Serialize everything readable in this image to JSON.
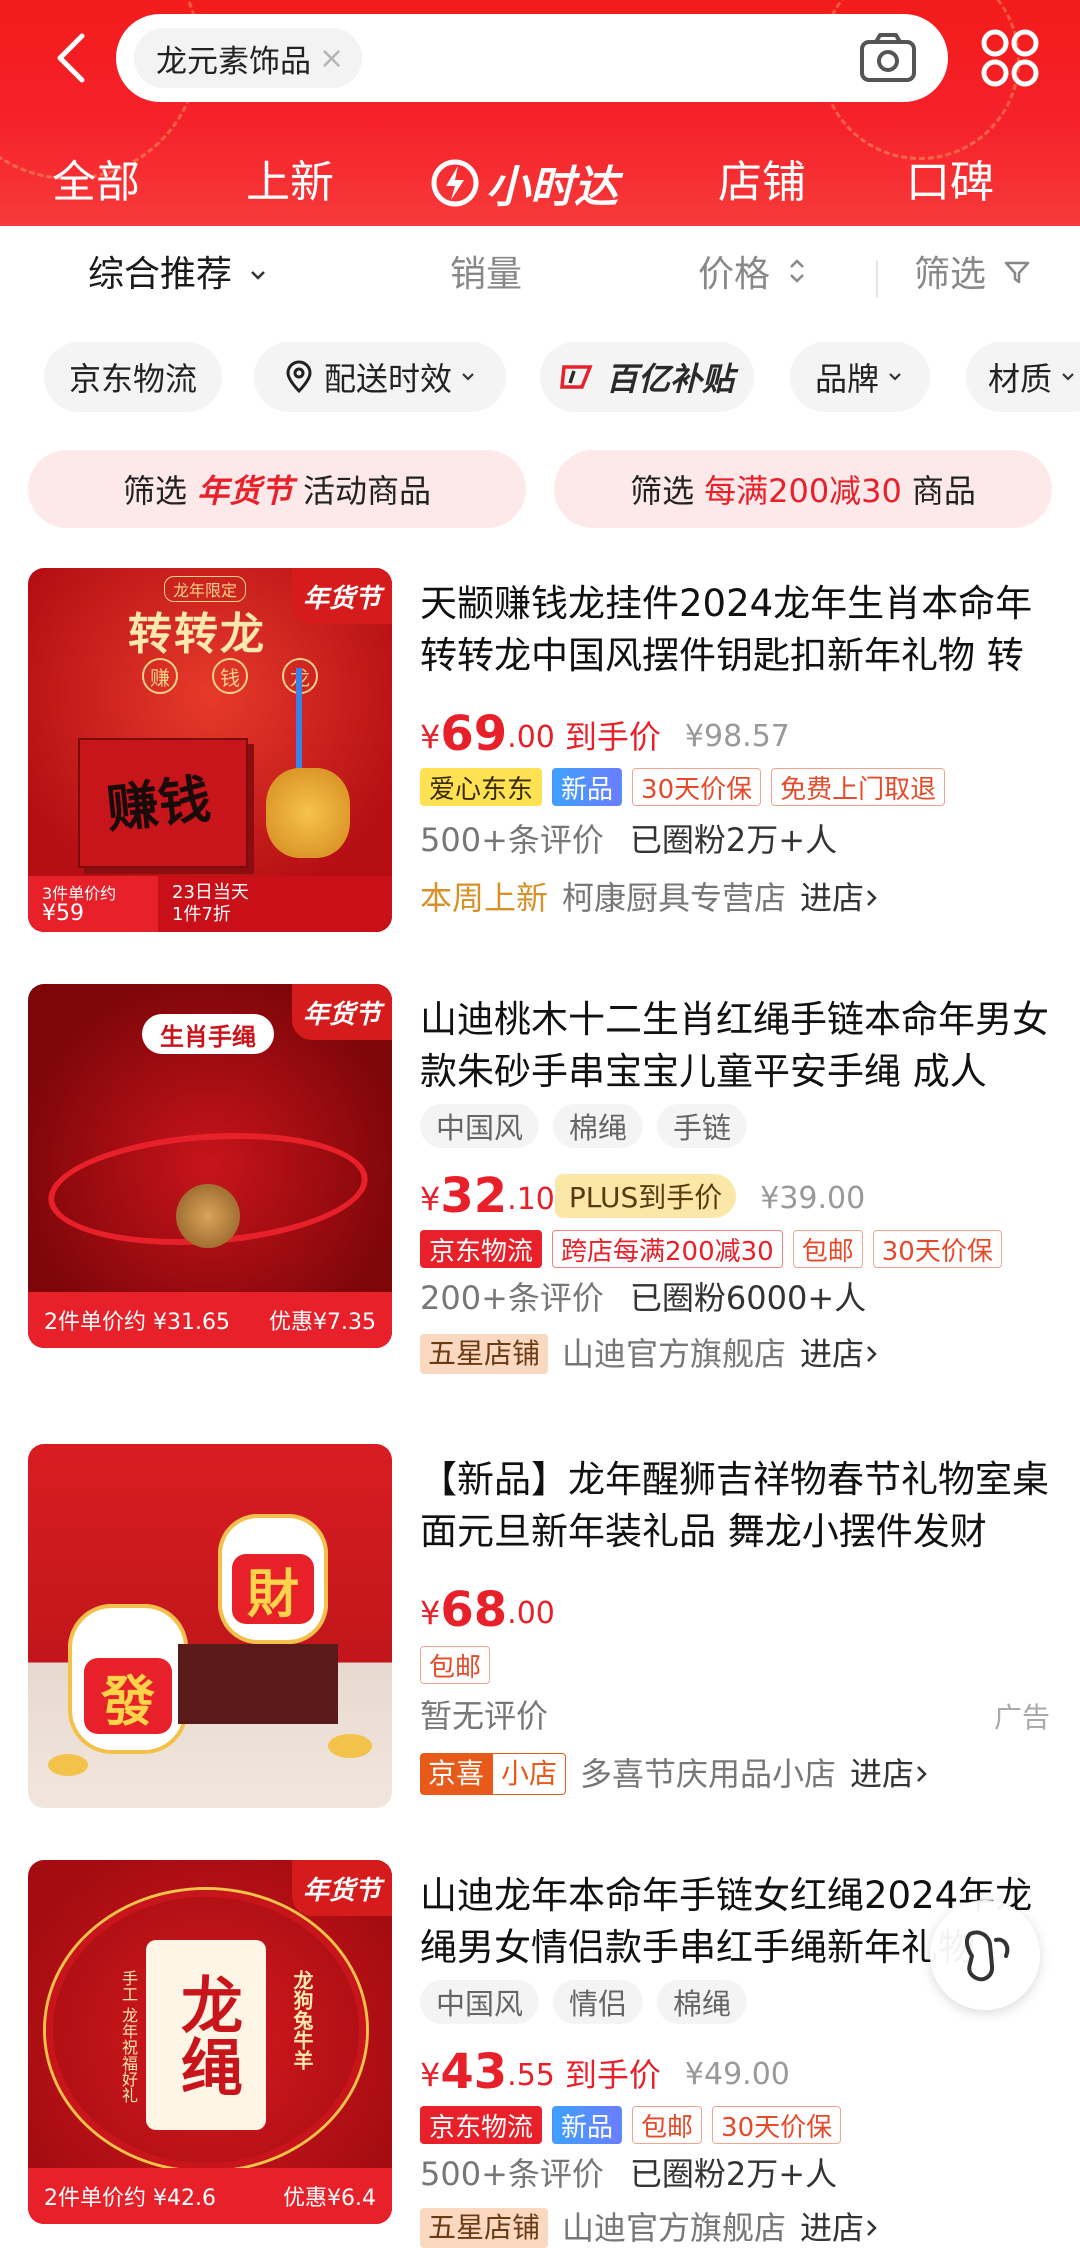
{
  "search": {
    "query": "龙元素饰品",
    "clear": "×"
  },
  "tabs": [
    {
      "label": "全部"
    },
    {
      "label": "上新"
    },
    {
      "label": "小时达"
    },
    {
      "label": "店铺"
    },
    {
      "label": "口碑"
    }
  ],
  "sort": {
    "overall": "综合推荐",
    "sales": "销量",
    "price": "价格",
    "filter": "筛选"
  },
  "filters": [
    "京东物流",
    "配送时效",
    "百亿补贴",
    "品牌",
    "材质"
  ],
  "promos": [
    {
      "prefix": "筛选",
      "highlight": "年货节",
      "suffix": "活动商品"
    },
    {
      "prefix": "筛选",
      "highlight": "每满200减30",
      "suffix": "商品"
    }
  ],
  "products": [
    {
      "title": "天颛赚钱龙挂件2024龙年生肖本命年转转龙中国风摆件钥匙扣新年礼物 转",
      "currency": "¥",
      "price_int": "69",
      "price_dec": ".00",
      "price_label": "到手价",
      "original": "¥98.57",
      "badges": [
        "爱心东东",
        "新品",
        "30天价保",
        "免费上门取退"
      ],
      "reviews": "500+条评价",
      "fans": "已圈粉2万+人",
      "shop_tag": "本周上新",
      "shop": "柯康厨具专营店",
      "enter": "进店",
      "thumb": {
        "top_label": "龙年限定",
        "title": "转转龙",
        "chars": [
          "赚",
          "钱",
          "龙"
        ],
        "badge": "年货节",
        "strip_left_1": "3件单价约",
        "strip_left_2": "¥59",
        "strip_right_1": "23日当天",
        "strip_right_2": "1件7折",
        "big_char": "赚钱"
      }
    },
    {
      "title": "山迪桃木十二生肖红绳手链本命年男女款朱砂手串宝宝儿童平安手绳 成人",
      "tags": [
        "中国风",
        "棉绳",
        "手链"
      ],
      "currency": "¥",
      "price_int": "32",
      "price_dec": ".10",
      "price_label": "PLUS到手价",
      "original": "¥39.00",
      "badges": [
        "京东物流",
        "跨店每满200减30",
        "包邮",
        "30天价保"
      ],
      "reviews": "200+条评价",
      "fans": "已圈粉6000+人",
      "shop_tag": "五星店铺",
      "shop": "山迪官方旗舰店",
      "enter": "进店",
      "thumb": {
        "title": "生肖手绳",
        "badge": "年货节",
        "strip_left": "2件单价约 ¥31.65",
        "strip_right": "优惠¥7.35"
      }
    },
    {
      "title": "【新品】龙年醒狮吉祥物春节礼物室桌面元旦新年装礼品 舞龙小摆件发财",
      "currency": "¥",
      "price_int": "68",
      "price_dec": ".00",
      "badges": [
        "包邮"
      ],
      "reviews": "暂无评价",
      "ad": "广告",
      "shop_tag_a": "京喜",
      "shop_tag_b": "小店",
      "shop": "多喜节庆用品小店",
      "enter": "进店",
      "thumb": {
        "char1": "財",
        "char2": "發"
      }
    },
    {
      "title": "山迪龙年本命年手链女红绳2024年龙绳男女情侣款手串红手绳新年礼物",
      "tags": [
        "中国风",
        "情侣",
        "棉绳"
      ],
      "currency": "¥",
      "price_int": "43",
      "price_dec": ".55",
      "price_label": "到手价",
      "original": "¥49.00",
      "badges": [
        "京东物流",
        "新品",
        "包邮",
        "30天价保"
      ],
      "reviews": "500+条评价",
      "fans": "已圈粉2万+人",
      "shop_tag": "五星店铺",
      "shop": "山迪官方旗舰店",
      "enter": "进店",
      "thumb": {
        "title": "龙绳",
        "side_left": "手工 龙年祝福好礼",
        "side_right": "龙狗兔牛羊",
        "badge": "年货节",
        "strip_left": "2件单价约 ¥42.6",
        "strip_right": "优惠¥6.4"
      }
    }
  ]
}
